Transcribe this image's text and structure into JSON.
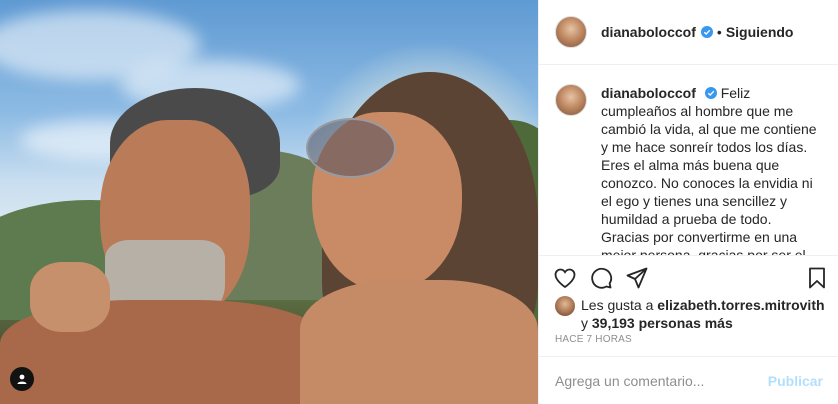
{
  "post": {
    "username": "dianaboloccof",
    "follow_status": "Siguiendo",
    "separator": "•",
    "caption_user": "dianaboloccof",
    "caption_text": "Feliz cumpleaños al hombre que me cambió la vida, al que me contiene y me hace sonreír todos los días. Eres el alma más buena que conozco. No conoces la envidia ni el ego y tienes una sencillez y humildad a prueba de todo. Gracias por convertirme en una mejor persona, gracias por ser el mejor ejemplo para nuestros hijos, gracias por iluminar la vida de quienes te rodean. Te",
    "likes_prefix": "Les gusta a",
    "likes_user": "elizabeth.torres.mitrovith",
    "likes_and": "y",
    "likes_count": "39,193 personas más",
    "time_ago": "HACE 7 HORAS",
    "comment_placeholder": "Agrega un comentario...",
    "publish_label": "Publicar"
  },
  "icons": {
    "verified": "verified-badge-icon",
    "like": "heart-icon",
    "comment": "comment-bubble-icon",
    "share": "share-icon",
    "save": "bookmark-icon",
    "tagged_user": "user-tag-icon"
  },
  "colors": {
    "verified": "#3897f0",
    "publish_disabled": "#b2dffc",
    "muted_text": "#8e8e8e",
    "border": "#efefef"
  }
}
